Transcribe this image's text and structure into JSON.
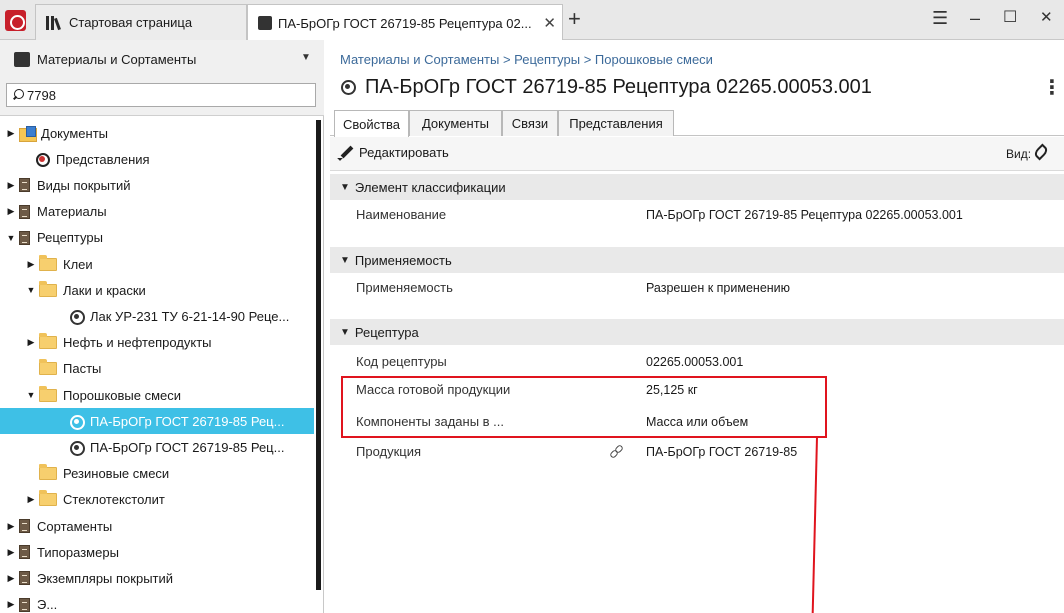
{
  "tabs": {
    "home_label": "Стартовая страница",
    "doc_label": "ПА-БрОГр ГОСТ 26719-85 Рецептура 02...",
    "close_glyph": "✕",
    "new_tab_glyph": "+"
  },
  "window": {
    "menu_glyph": "☰",
    "minimize_glyph": "–",
    "maximize_glyph": "☐",
    "close_glyph": "✕"
  },
  "sidebar": {
    "title": "Материалы и Сортаменты",
    "search_value": "7798",
    "tree": [
      {
        "label": "Документы",
        "toggle": "▶",
        "icon": "docs-folder-icon"
      },
      {
        "label": "Представления",
        "toggle": "",
        "icon": "views-icon"
      },
      {
        "label": "Виды покрытий",
        "toggle": "▶",
        "icon": "book-icon"
      },
      {
        "label": "Материалы",
        "toggle": "▶",
        "icon": "book-icon"
      },
      {
        "label": "Рецептуры",
        "toggle": "▼",
        "icon": "book-icon"
      },
      {
        "label": "Клеи",
        "toggle": "▶",
        "icon": "folder-icon"
      },
      {
        "label": "Лаки и краски",
        "toggle": "▼",
        "icon": "folder-icon"
      },
      {
        "label": "Лак УР-231 ТУ 6-21-14-90 Реце...",
        "toggle": "",
        "icon": "recipe-icon"
      },
      {
        "label": "Нефть и нефтепродукты",
        "toggle": "▶",
        "icon": "folder-icon"
      },
      {
        "label": "Пасты",
        "toggle": "",
        "icon": "folder-icon"
      },
      {
        "label": "Порошковые смеси",
        "toggle": "▼",
        "icon": "folder-icon"
      },
      {
        "label": "ПА-БрОГр ГОСТ 26719-85 Рец...",
        "toggle": "",
        "icon": "recipe-icon"
      },
      {
        "label": "ПА-БрОГр ГОСТ 26719-85 Рец...",
        "toggle": "",
        "icon": "recipe-icon"
      },
      {
        "label": "Резиновые смеси",
        "toggle": "",
        "icon": "folder-icon"
      },
      {
        "label": "Стеклотекстолит",
        "toggle": "▶",
        "icon": "folder-icon"
      },
      {
        "label": "Сортаменты",
        "toggle": "▶",
        "icon": "book-icon"
      },
      {
        "label": "Типоразмеры",
        "toggle": "▶",
        "icon": "book-icon"
      },
      {
        "label": "Экземпляры покрытий",
        "toggle": "▶",
        "icon": "book-icon"
      },
      {
        "label": "Э...",
        "toggle": "▶",
        "icon": "book-icon"
      }
    ],
    "selected_index": 11
  },
  "main": {
    "breadcrumb": "Материалы и Сортаменты > Рецептуры > Порошковые смеси",
    "title": "ПА-БрОГр ГОСТ 26719-85 Рецептура 02265.00053.001",
    "subtabs": [
      "Свойства",
      "Документы",
      "Связи",
      "Представления"
    ],
    "active_subtab": 0,
    "toolbar": {
      "edit_label": "Редактировать",
      "view_label": "Вид:"
    },
    "sections": [
      {
        "title": "Элемент классификации",
        "rows": [
          {
            "label": "Наименование",
            "value": "ПА-БрОГр ГОСТ 26719-85 Рецептура 02265.00053.001"
          }
        ]
      },
      {
        "title": "Применяемость",
        "rows": [
          {
            "label": "Применяемость",
            "value": "Разрешен к применению"
          }
        ]
      },
      {
        "title": "Рецептура",
        "rows": [
          {
            "label": "Код рецептуры",
            "value": "02265.00053.001"
          },
          {
            "label": "Масса готовой продукции",
            "value": "25,125  кг"
          },
          {
            "label": "Компоненты заданы в ...",
            "value": "Масса или объем"
          },
          {
            "label": "Продукция",
            "value": "ПА-БрОГр ГОСТ 26719-85"
          }
        ]
      }
    ]
  },
  "colors": {
    "selection": "#3ec0e6",
    "highlight": "#e0141e",
    "breadcrumb": "#3c6a9a",
    "section_bg": "#e9e9e9"
  }
}
